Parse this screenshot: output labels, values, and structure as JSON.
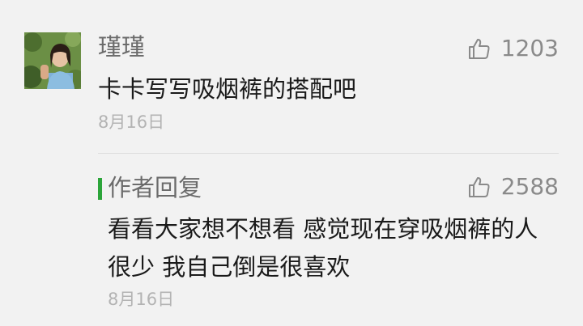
{
  "comment": {
    "username": "瑾瑾",
    "avatar_icon": "user-avatar-photo",
    "like_icon": "thumbs-up-icon",
    "like_count": "1203",
    "text": "卡卡写写吸烟裤的搭配吧",
    "date": "8月16日"
  },
  "reply": {
    "label": "作者回复",
    "like_icon": "thumbs-up-icon",
    "like_count": "2588",
    "text": "看看大家想不想看 感觉现在穿吸烟裤的人很少 我自己倒是很喜欢",
    "date": "8月16日"
  },
  "colors": {
    "background": "#f2f2f2",
    "author_bar": "#2ca53a",
    "secondary_text": "#6b6b6b",
    "date_text": "#b3b3b3"
  }
}
